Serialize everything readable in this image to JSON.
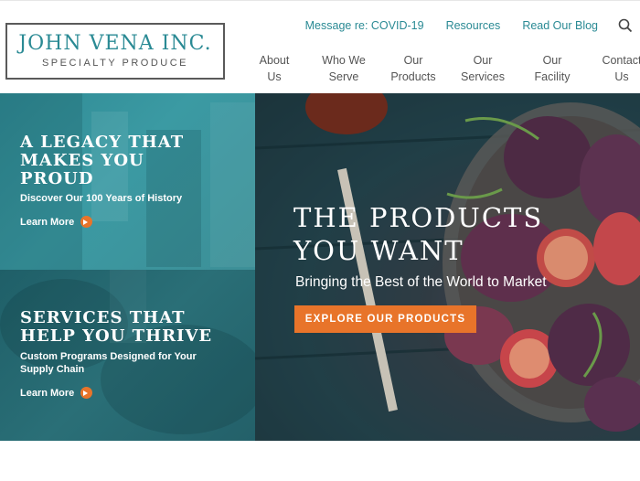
{
  "logo": {
    "main": "JOHN VENA INC.",
    "sub": "SPECIALTY PRODUCE"
  },
  "utility_nav": [
    {
      "label": "Message re: COVID-19"
    },
    {
      "label": "Resources"
    },
    {
      "label": "Read Our Blog"
    }
  ],
  "search": {
    "icon": "search-icon"
  },
  "main_nav": [
    {
      "line1": "About",
      "line2": "Us"
    },
    {
      "line1": "Who We",
      "line2": "Serve"
    },
    {
      "line1": "Our",
      "line2": "Products"
    },
    {
      "line1": "Our",
      "line2": "Services"
    },
    {
      "line1": "Our",
      "line2": "Facility"
    },
    {
      "line1": "Contact",
      "line2": "Us"
    }
  ],
  "panel_legacy": {
    "title_line1": "A LEGACY THAT",
    "title_line2": "MAKES YOU",
    "title_line3": "PROUD",
    "subtitle": "Discover Our 100 Years of History",
    "link": "Learn More"
  },
  "panel_services": {
    "title_line1": "SERVICES THAT",
    "title_line2": "HELP YOU THRIVE",
    "subtitle": "Custom Programs Designed for Your Supply Chain",
    "link": "Learn More"
  },
  "hero": {
    "title_line1": "THE PRODUCTS",
    "title_line2": "YOU WANT",
    "subtitle": "Bringing the Best of the World to Market",
    "cta": "EXPLORE OUR PRODUCTS"
  },
  "colors": {
    "brand_teal": "#2a8a94",
    "accent_orange": "#e8742a"
  }
}
